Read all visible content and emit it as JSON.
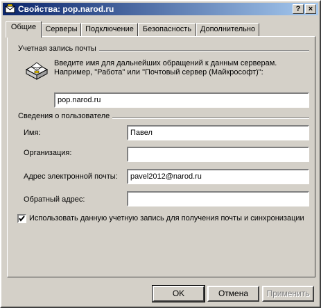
{
  "window": {
    "title": "Свойства: pop.narod.ru",
    "help_label": "?",
    "close_label": "×"
  },
  "tabs": [
    {
      "label": "Общие",
      "active": true
    },
    {
      "label": "Серверы"
    },
    {
      "label": "Подключение"
    },
    {
      "label": "Безопасность"
    },
    {
      "label": "Дополнительно"
    }
  ],
  "account": {
    "group_label": "Учетная запись почты",
    "description": "Введите имя для дальнейших обращений к данным серверам. Например, \"Работа\" или \"Почтовый сервер (Майкрософт)\":",
    "name_value": "pop.narod.ru",
    "icon": "mail-server-icon"
  },
  "user": {
    "group_label": "Сведения о пользователе",
    "name_label": "Имя:",
    "name_value": "Павел",
    "org_label": "Организация:",
    "org_value": "",
    "email_label": "Адрес электронной почты:",
    "email_value": "pavel2012@narod.ru",
    "reply_label": "Обратный адрес:",
    "reply_value": ""
  },
  "include_checkbox": {
    "label": "Использовать данную учетную запись для получения почты и синхронизации",
    "checked": true
  },
  "buttons": {
    "ok": "OK",
    "cancel": "Отмена",
    "apply": "Применить"
  },
  "colors": {
    "face": "#d4d0c8",
    "title_start": "#0a246a",
    "title_end": "#a6caf0"
  }
}
